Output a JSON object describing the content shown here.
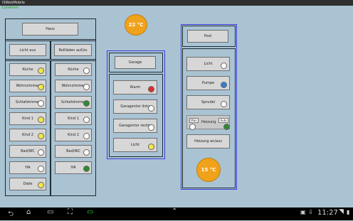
{
  "app": {
    "title": "ISWebMobile"
  },
  "status": {
    "text": "Lunahem"
  },
  "haus": {
    "header": "Haus",
    "left_top": "Licht aus",
    "right_top": "Rollläden auf/zu",
    "left_items": [
      {
        "label": "Küche",
        "color": "#f2e64a"
      },
      {
        "label": "Wohnzimmer",
        "color": "#f2e64a"
      },
      {
        "label": "Schlafzimmer",
        "color": "#ffffff"
      },
      {
        "label": "Kind 1",
        "color": "#f2e64a"
      },
      {
        "label": "Kind 2",
        "color": "#f2e64a"
      },
      {
        "label": "Bad/WC",
        "color": "#ffffff"
      },
      {
        "label": "HA",
        "color": "#ffffff"
      },
      {
        "label": "Diele",
        "color": "#f2e64a"
      }
    ],
    "right_items": [
      {
        "label": "Küche",
        "color": "#ffffff"
      },
      {
        "label": "Wohnzimmer",
        "color": "#ffffff"
      },
      {
        "label": "Schlafzimmer",
        "color": "#2e8b2e"
      },
      {
        "label": "Kind 1",
        "color": "#ffffff"
      },
      {
        "label": "Kind 2",
        "color": "#ffffff"
      },
      {
        "label": "Bad/WC",
        "color": "#ffffff"
      },
      {
        "label": "HA",
        "color": "#2e8b2e"
      }
    ]
  },
  "garage": {
    "header": "Garage",
    "temp": "22 °C",
    "items": [
      {
        "label": "Alarm",
        "color": "#e02a2a"
      },
      {
        "label": "Garagentor links",
        "color": "#ffffff"
      },
      {
        "label": "Garagentor rechts",
        "color": "#ffffff"
      },
      {
        "label": "Licht",
        "color": "#f2e64a"
      }
    ]
  },
  "pool": {
    "header": "Pool",
    "temp": "15 °C",
    "items": [
      {
        "label": "Licht",
        "color": "#ffffff"
      },
      {
        "label": "Pumpe",
        "color": "#2e7fd6"
      },
      {
        "label": "Sprudel",
        "color": "#ffffff"
      }
    ],
    "heizung": {
      "label": "Heizung",
      "left": "Man",
      "right": "Auto",
      "left_dot": "#ffffff",
      "right_dot": "#2e8b2e"
    },
    "heizung_toggle": "Heizung an/aus"
  },
  "nav": {
    "clock": "11:27"
  }
}
